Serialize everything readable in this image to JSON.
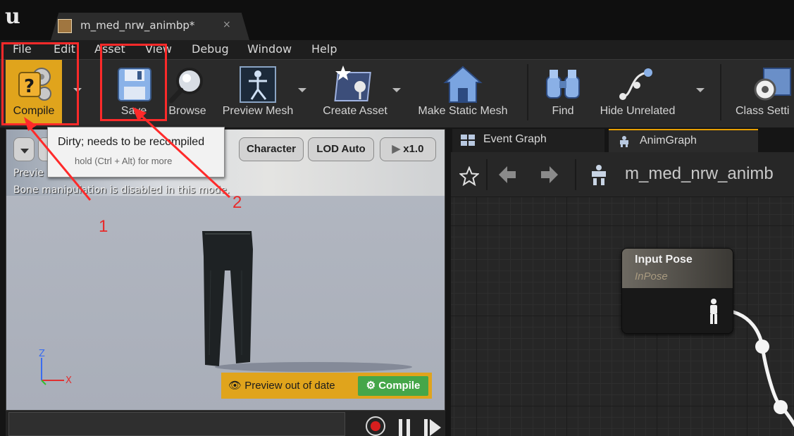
{
  "window": {
    "tab_title": "m_med_nrw_animbp*",
    "tab_close": "×"
  },
  "menu": [
    "File",
    "Edit",
    "Asset",
    "View",
    "Debug",
    "Window",
    "Help"
  ],
  "toolbar": {
    "compile": "Compile",
    "save": "Save",
    "browse": "Browse",
    "preview_mesh": "Preview Mesh",
    "create_asset": "Create Asset",
    "make_static_mesh": "Make Static Mesh",
    "find": "Find",
    "hide_unrelated": "Hide Unrelated",
    "class_settings": "Class Setti"
  },
  "tooltip": {
    "title": "Dirty; needs to be recompiled",
    "subtitle": "hold (Ctrl + Alt) for more"
  },
  "viewport": {
    "pill_character": "Character",
    "pill_lod": "LOD Auto",
    "pill_speed": "x1.0",
    "info_line1": "Previe",
    "info_line2": "Bone manipulation is disabled in this mode.",
    "axis_z": "Z",
    "axis_x": "X",
    "preview_warning": "Preview out of date",
    "preview_compile": "Compile"
  },
  "graph": {
    "tab_event": "Event Graph",
    "tab_anim": "AnimGraph",
    "title": "m_med_nrw_animb",
    "node_title": "Input Pose",
    "node_subtitle": "InPose"
  },
  "annotations": {
    "label_1": "1",
    "label_2": "2",
    "color": "#ff2a2a"
  },
  "colors": {
    "compile_button_bg": "#e0a41c",
    "preview_compile_bg": "#45a649",
    "active_tab_accent": "#e8a000"
  }
}
